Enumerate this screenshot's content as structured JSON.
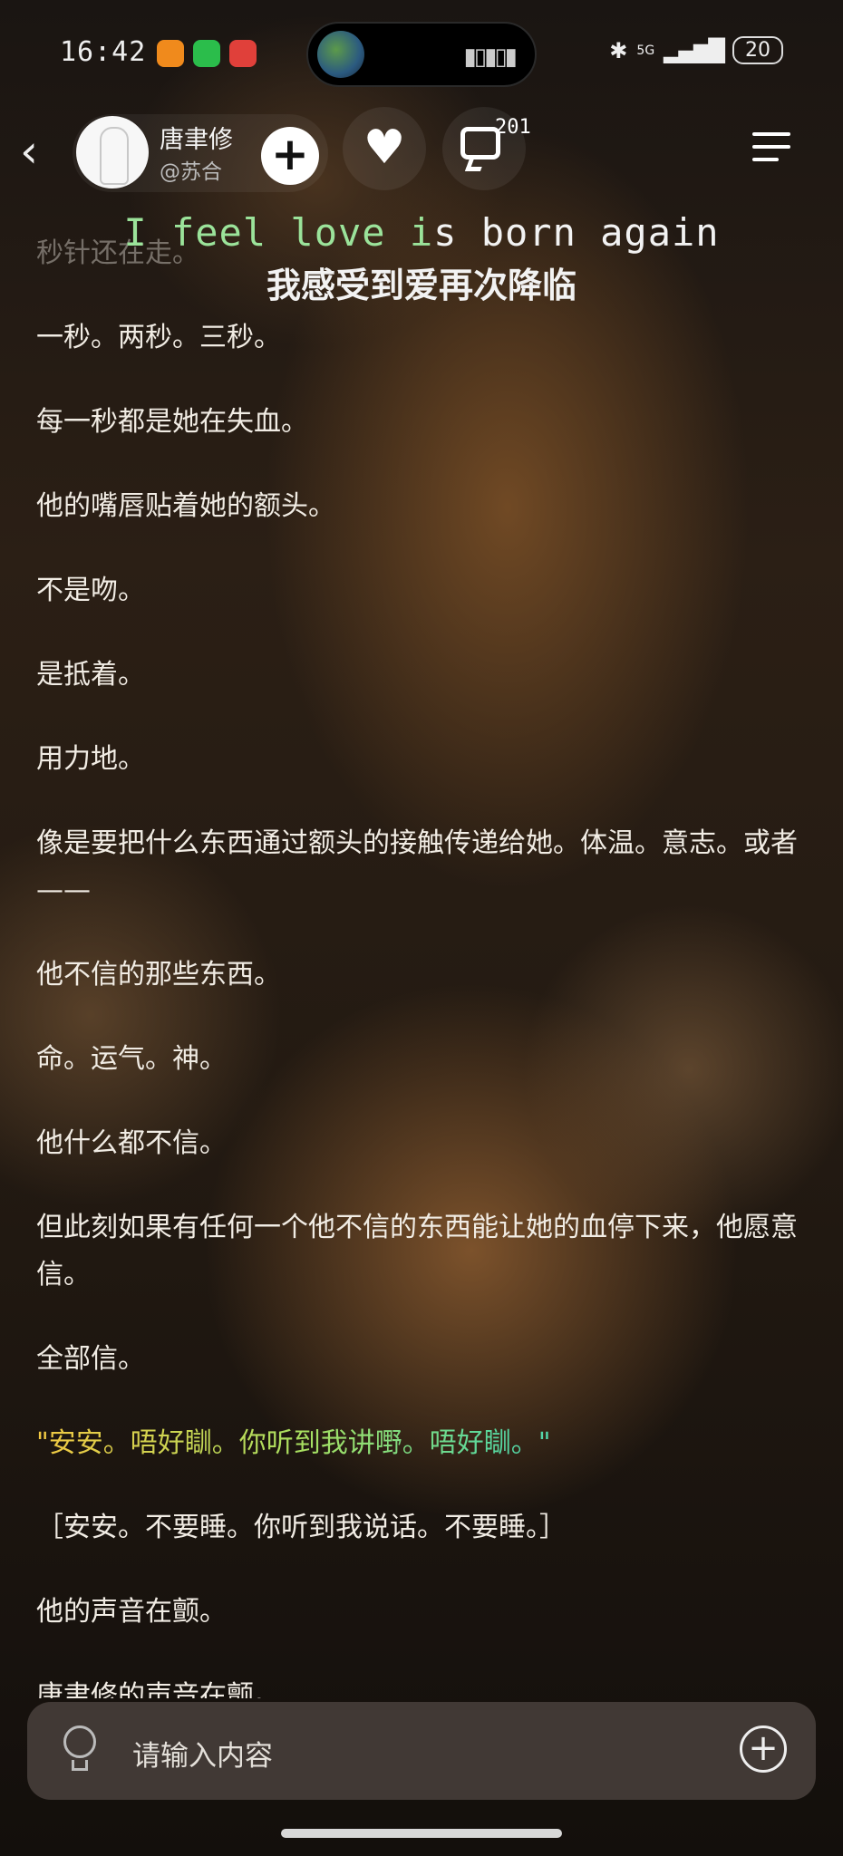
{
  "status_bar": {
    "time": "16:42",
    "network": "5G",
    "battery": "20"
  },
  "header": {
    "author_name": "唐聿修",
    "author_handle": "@苏合",
    "comment_count": "201"
  },
  "lyrics": {
    "english_sung": "I feel love i",
    "english_unsung": "s born again",
    "chinese": "我感受到爱再次降临"
  },
  "content": {
    "paragraphs": [
      "秒针还在走。",
      "一秒。两秒。三秒。",
      "每一秒都是她在失血。",
      "他的嘴唇贴着她的额头。",
      "不是吻。",
      "是抵着。",
      "用力地。",
      "像是要把什么东西通过额头的接触传递给她。体温。意志。或者——",
      "他不信的那些东西。",
      "命。运气。神。",
      "他什么都不信。",
      "但此刻如果有任何一个他不信的东西能让她的血停下来，他愿意信。",
      "全部信。",
      "\"安安。唔好瞓。你听到我讲嘢。唔好瞓。\"",
      "［安安。不要睡。你听到我说话。不要睡。］",
      "他的声音在颤。",
      "唐聿修的声音在颤。"
    ]
  },
  "input": {
    "placeholder": "请输入内容"
  },
  "colors": {
    "lyric_highlight": "#9be39a",
    "rainbow_start": "#f2c842",
    "rainbow_end": "#3fd3e8"
  }
}
